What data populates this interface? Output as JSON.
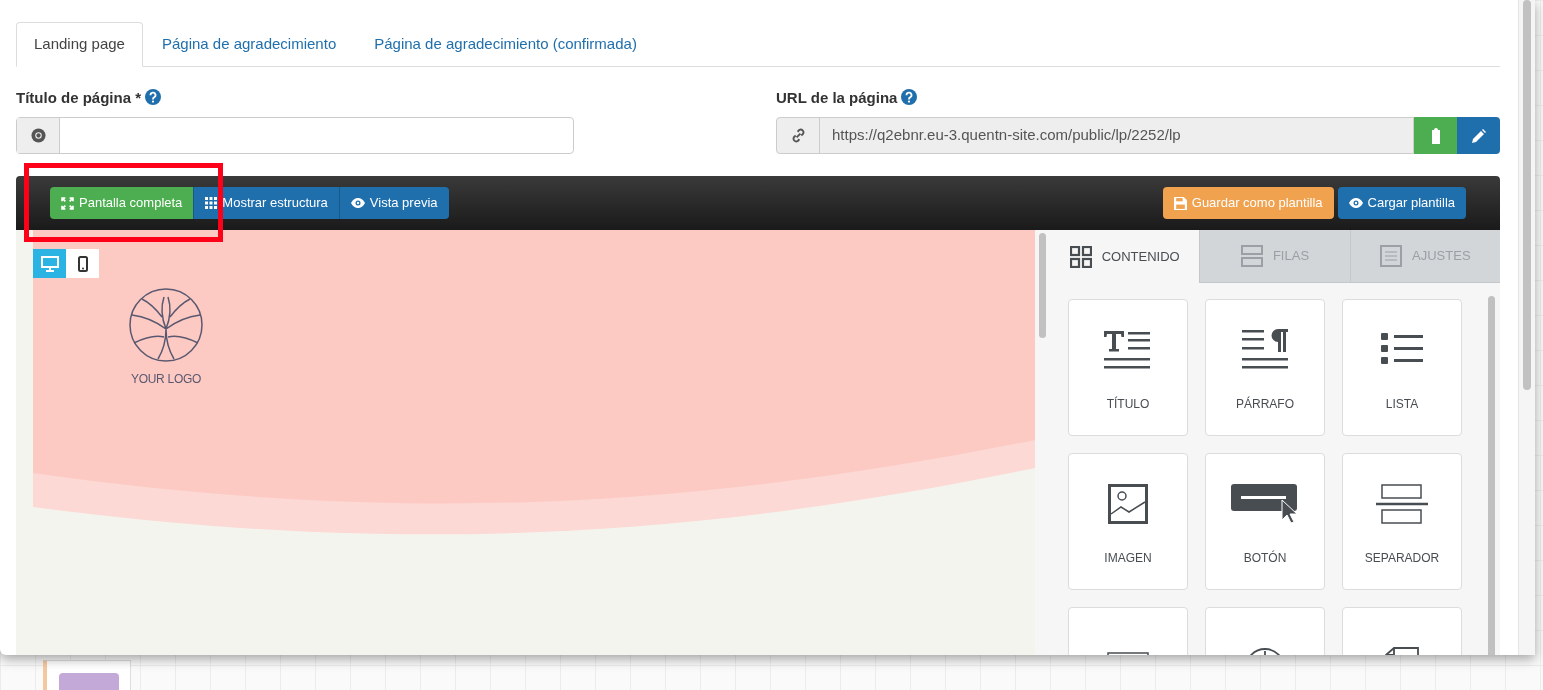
{
  "tabs": [
    {
      "label": "Landing page",
      "selected": true
    },
    {
      "label": "Página de agradecimiento",
      "selected": false
    },
    {
      "label": "Página de agradecimiento (confirmada)",
      "selected": false
    }
  ],
  "title_field": {
    "label": "Título de página *"
  },
  "url_field": {
    "label": "URL de la página",
    "value": "https://q2ebnr.eu-3.quentn-site.com/public/lp/2252/lp"
  },
  "toolbar_left": [
    {
      "kind": "fullscreen",
      "label": "Pantalla completa"
    },
    {
      "kind": "structure",
      "label": "Mostrar estructura"
    },
    {
      "kind": "preview",
      "label": "Vista previa"
    }
  ],
  "toolbar_right": [
    {
      "kind": "save",
      "label": "Guardar como plantilla"
    },
    {
      "kind": "load",
      "label": "Cargar plantilla"
    }
  ],
  "device_toggle": [
    {
      "kind": "desktop",
      "selected": true
    },
    {
      "kind": "mobile",
      "selected": false
    }
  ],
  "preview": {
    "logo_text": "YOUR LOGO"
  },
  "panel_tabs": [
    {
      "kind": "content",
      "label": "CONTENIDO",
      "selected": true
    },
    {
      "kind": "rows",
      "label": "FILAS",
      "selected": false
    },
    {
      "kind": "settings",
      "label": "AJUSTES",
      "selected": false
    }
  ],
  "blocks": [
    {
      "kind": "title",
      "label": "TÍTULO"
    },
    {
      "kind": "paragraph",
      "label": "PÁRRAFO"
    },
    {
      "kind": "list",
      "label": "LISTA"
    },
    {
      "kind": "image",
      "label": "IMAGEN"
    },
    {
      "kind": "button",
      "label": "BOTÓN"
    },
    {
      "kind": "divider",
      "label": "SEPARADOR"
    },
    {
      "kind": "frame"
    },
    {
      "kind": "clock"
    },
    {
      "kind": "document"
    }
  ]
}
